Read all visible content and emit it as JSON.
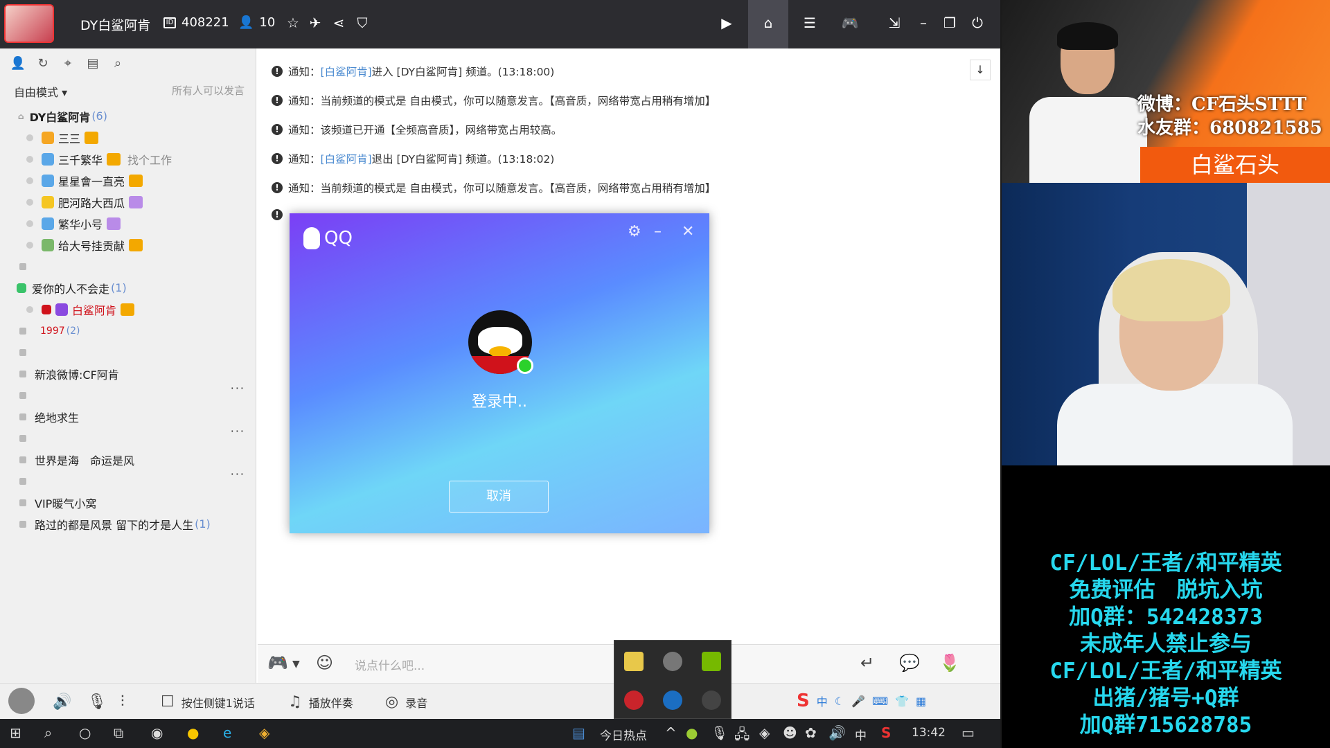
{
  "titlebar": {
    "channel_name": "DY白鲨阿肯",
    "channel_id": "408221",
    "user_count": "10"
  },
  "left": {
    "mode": "自由模式 ▾",
    "mode_note": "所有人可以发言",
    "root": {
      "name": "DY白鲨阿肯",
      "count": "(6)"
    },
    "members": [
      {
        "name": "三三",
        "note": ""
      },
      {
        "name": "三千繁华",
        "note": "找个工作"
      },
      {
        "name": "星星會一直亮",
        "note": ""
      },
      {
        "name": "肥河路大西瓜",
        "note": ""
      },
      {
        "name": "繁华小号",
        "note": ""
      },
      {
        "name": "给大号挂贡献",
        "note": ""
      }
    ],
    "group2": {
      "name": "爱你的人不会走",
      "count": "(1)"
    },
    "group2_member": "白鲨阿肯",
    "sub1997": {
      "name": "1997",
      "count": "(2)"
    },
    "channels": [
      "新浪微博:CF阿肯",
      "绝地求生",
      "世界是海　命运是风",
      "VIP暖气小窝"
    ],
    "last_channel": {
      "name": "路过的都是风景  留下的才是人生",
      "count": "(1)"
    },
    "more": "···"
  },
  "chat": {
    "prefix": "通知：",
    "messages": [
      {
        "pre": "",
        "link": "[白鲨阿肯]",
        "text": " 进入 [DY白鲨阿肯] 频道。(13:18:00)"
      },
      {
        "pre": "当前频道的模式是 自由模式，你可以随意发言。【高音质，网络带宽占用稍有增加】",
        "link": "",
        "text": ""
      },
      {
        "pre": "该频道已开通【全频高音质】，网络带宽占用较高。",
        "link": "",
        "text": ""
      },
      {
        "pre": "",
        "link": "[白鲨阿肯]",
        "text": " 退出 [DY白鲨阿肯] 频道。(13:18:02)"
      },
      {
        "pre": "当前频道的模式是 自由模式，你可以随意发言。【高音质，网络带宽占用稍有增加】",
        "link": "",
        "text": ""
      }
    ],
    "input_placeholder": "说点什么吧..."
  },
  "bottom": {
    "ptt": "按住侧键1说话",
    "music": "播放伴奏",
    "record": "录音"
  },
  "qq": {
    "brand": "QQ",
    "status": "登录中..",
    "cancel": "取消"
  },
  "taskbar": {
    "news": "今日热点",
    "ime": "中",
    "time": "13:42"
  },
  "stream": {
    "weibo": "微博：CF石头STTT",
    "fans": "水友群：680821585",
    "name": "白鲨石头",
    "promo": [
      "CF/LOL/王者/和平精英",
      "免费评估　脱坑入坑",
      "加Q群：542428373",
      "未成年人禁止参与",
      "CF/LOL/王者/和平精英",
      "出猪/猪号+Q群",
      "加Q群715628785"
    ]
  },
  "colors": {
    "titlebar": "#2c2c30",
    "link": "#4a8ad0",
    "promo_cyan": "#27d8ee",
    "promo_green": "#b7ff2e",
    "banner_orange": "#f5711a"
  }
}
